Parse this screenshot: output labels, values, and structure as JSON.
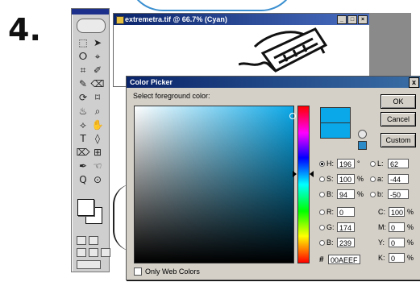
{
  "step_label": "4.",
  "document_window": {
    "title": "extremetra.tif @ 66.7% (Cyan)",
    "controls": [
      "_",
      "□",
      "×"
    ]
  },
  "toolbox": {
    "tools": [
      "⬚",
      "➤",
      "ⵔ",
      "⌖",
      "⌗",
      "✐",
      "✎",
      "⌫",
      "⟳",
      "⌑",
      "♨",
      "⌕",
      "⟡",
      "✋",
      "T",
      "◊",
      "⌦",
      "⊞",
      "✒",
      "☜",
      "Q",
      "⊙"
    ]
  },
  "color_picker": {
    "title": "Color Picker",
    "close_label": "x",
    "select_label": "Select foreground color:",
    "buttons": {
      "ok": "OK",
      "cancel": "Cancel",
      "custom": "Custom"
    },
    "colors": {
      "current": "#0aa8e8",
      "previous": "#0aa8e8"
    },
    "hsb": [
      {
        "label": "H:",
        "value": "196",
        "unit": "°",
        "selected": true
      },
      {
        "label": "S:",
        "value": "100",
        "unit": "%",
        "selected": false
      },
      {
        "label": "B:",
        "value": "94",
        "unit": "%",
        "selected": false
      }
    ],
    "rgb": [
      {
        "label": "R:",
        "value": "0",
        "selected": false
      },
      {
        "label": "G:",
        "value": "174",
        "selected": false
      },
      {
        "label": "B:",
        "value": "239",
        "selected": false
      }
    ],
    "lab": [
      {
        "label": "L:",
        "value": "62",
        "selected": false
      },
      {
        "label": "a:",
        "value": "-44",
        "selected": false
      },
      {
        "label": "b:",
        "value": "-50",
        "selected": false
      }
    ],
    "cmyk": [
      {
        "label": "C:",
        "value": "100",
        "unit": "%"
      },
      {
        "label": "M:",
        "value": "0",
        "unit": "%"
      },
      {
        "label": "Y:",
        "value": "0",
        "unit": "%"
      },
      {
        "label": "K:",
        "value": "0",
        "unit": "%"
      }
    ],
    "hex_label": "#",
    "hex_value": "00AEEF",
    "only_web_colors": "Only Web Colors"
  }
}
